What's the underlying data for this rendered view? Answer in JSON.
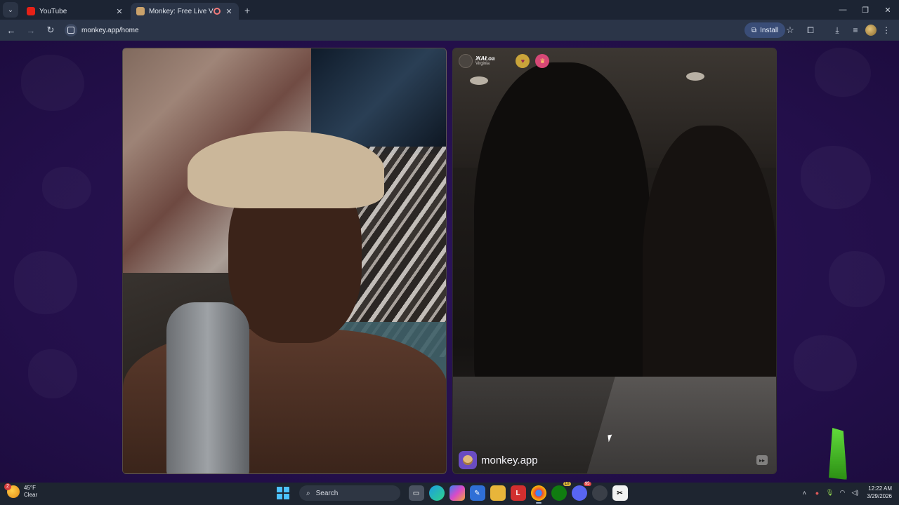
{
  "browser": {
    "tabs": [
      {
        "title": "YouTube",
        "favicon": "youtube-favicon",
        "active": false
      },
      {
        "title": "Monkey: Free Live Video Ch",
        "favicon": "monkey-favicon",
        "active": true
      }
    ],
    "url": "monkey.app/home",
    "install_label": "Install"
  },
  "video_chat": {
    "peer": {
      "name": "ЖAŁoa",
      "location": "Virginia",
      "badges": [
        "heart-badge",
        "gift-badge"
      ]
    },
    "watermark": "monkey.app",
    "skip_icon": "fast-forward-icon"
  },
  "taskbar": {
    "weather": {
      "temp": "45°F",
      "condition": "Clear",
      "alerts": "2"
    },
    "search_placeholder": "Search",
    "time": "12:22 AM",
    "date": "3/29/2026",
    "badge_xbox": "10",
    "badge_discord": "95"
  }
}
